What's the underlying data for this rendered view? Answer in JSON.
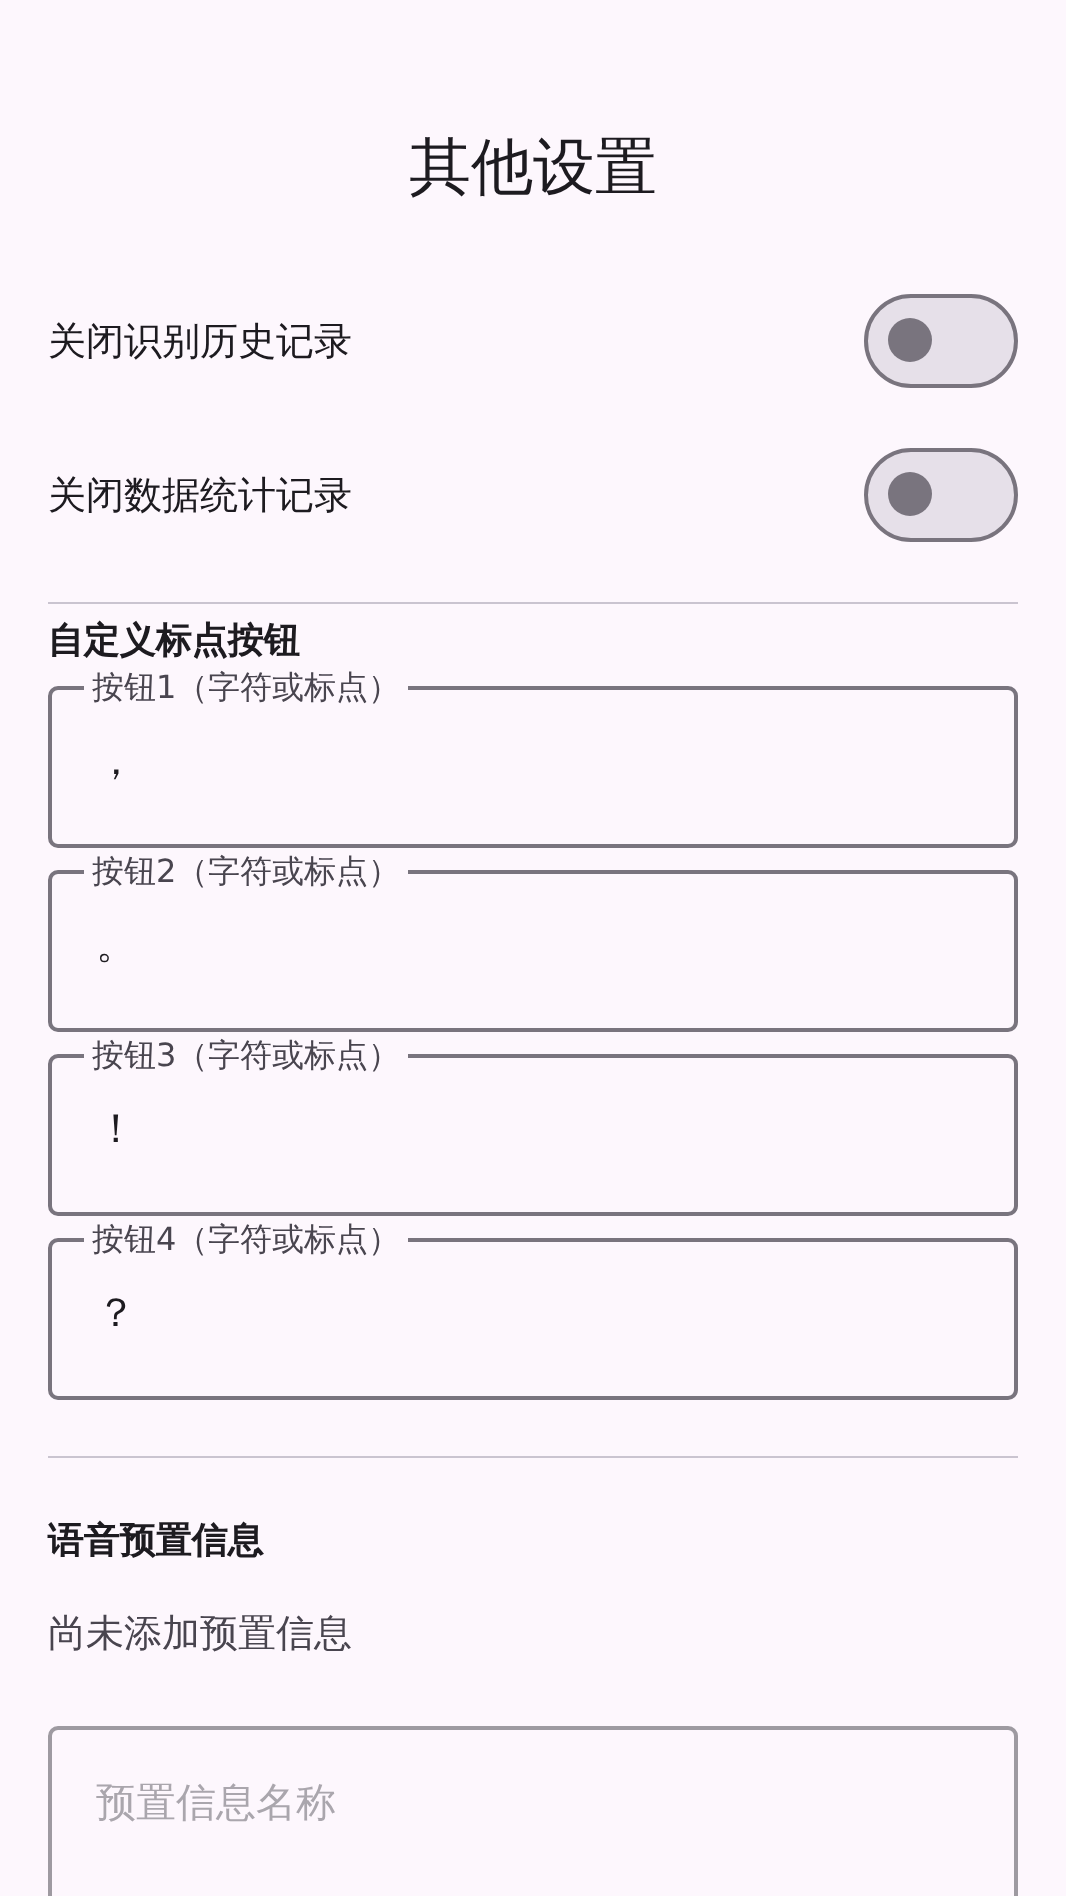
{
  "title": "其他设置",
  "toggles": [
    {
      "label": "关闭识别历史记录",
      "on": false
    },
    {
      "label": "关闭数据统计记录",
      "on": false
    }
  ],
  "punctuation_section": {
    "heading": "自定义标点按钮",
    "fields": [
      {
        "label": "按钮1（字符或标点）",
        "value": "，"
      },
      {
        "label": "按钮2（字符或标点）",
        "value": "。"
      },
      {
        "label": "按钮3（字符或标点）",
        "value": "！"
      },
      {
        "label": "按钮4（字符或标点）",
        "value": "？"
      }
    ]
  },
  "voice_section": {
    "heading": "语音预置信息",
    "empty_text": "尚未添加预置信息",
    "name_field": {
      "placeholder": "预置信息名称"
    }
  }
}
